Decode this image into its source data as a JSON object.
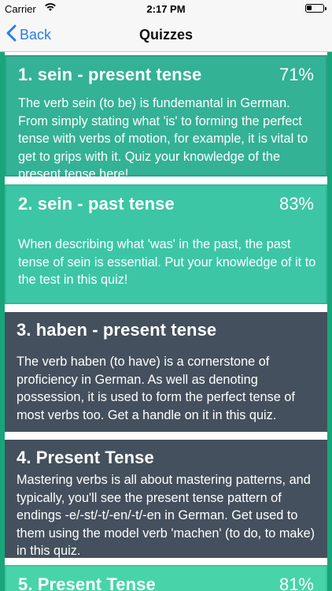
{
  "status_bar": {
    "carrier": "Carrier",
    "time": "2:17 PM",
    "wifi_icon": "wifi-icon",
    "battery_icon": "battery-icon"
  },
  "nav": {
    "back_label": "Back",
    "title": "Quizzes"
  },
  "colors": {
    "accent": "#2b7bf0",
    "completed_card": "#33b295",
    "completed_card_light": "#3cc6a6",
    "incomplete_card": "#44505d",
    "frame": "#19a57a"
  },
  "quizzes": [
    {
      "title": "1. sein - present tense",
      "score": "71%",
      "description": "The verb sein (to be) is fundemantal in German. From simply stating what 'is' to forming the perfect tense with verbs of motion, for example, it is vital to get to grips with it. Quiz your knowledge of the present tense here!"
    },
    {
      "title": "2. sein - past tense",
      "score": "83%",
      "description": "When describing what 'was' in the past, the past tense of sein is essential. Put your knowledge of it to the test in this quiz!"
    },
    {
      "title": "3. haben - present tense",
      "score": "",
      "description": "The verb haben (to have) is a cornerstone of proficiency in German. As well as denoting possession, it is used to form the perfect tense of most verbs too. Get a handle on it in this quiz."
    },
    {
      "title": "4. Present Tense",
      "score": "",
      "description": "Mastering verbs is all about mastering patterns, and typically, you'll see the present tense pattern of endings -e/-st/-t/-en/-t/-en in German. Get used to them using the model verb 'machen' (to do, to make) in this quiz."
    },
    {
      "title": "5. Present Tense",
      "score": "81%",
      "description": ""
    }
  ]
}
